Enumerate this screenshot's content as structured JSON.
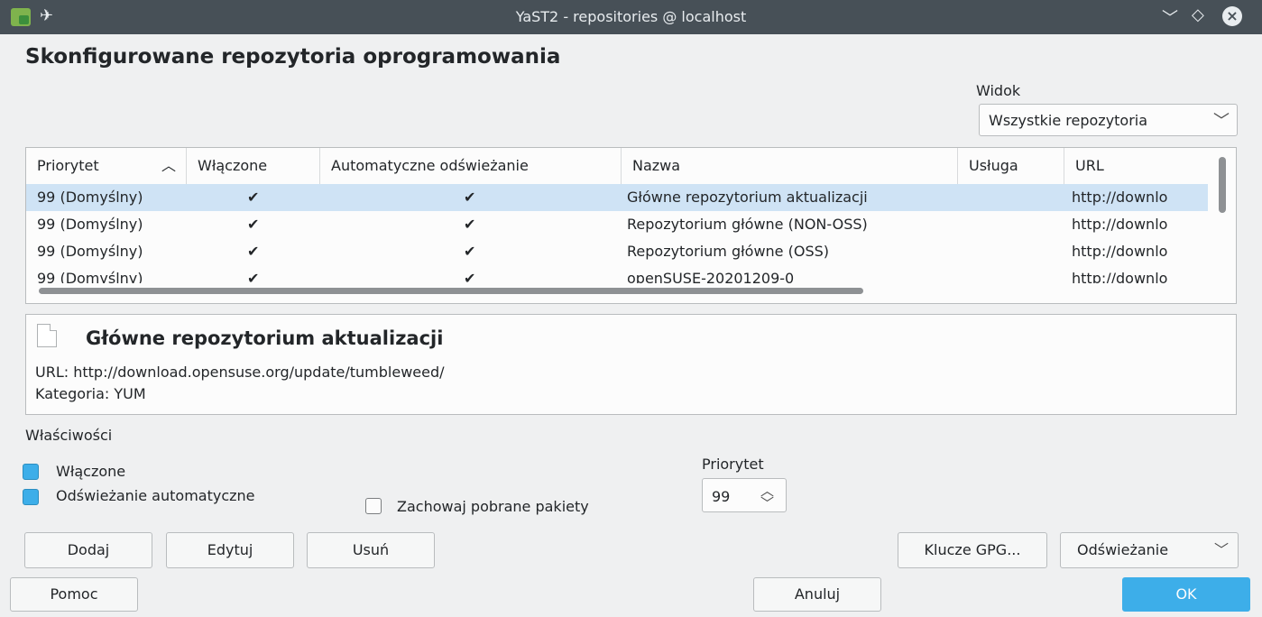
{
  "window": {
    "title": "YaST2 - repositories @ localhost"
  },
  "heading": "Skonfigurowane repozytoria oprogramowania",
  "view": {
    "label": "Widok",
    "selected": "Wszystkie repozytoria"
  },
  "table": {
    "columns": [
      "Priorytet",
      "Włączone",
      "Automatyczne odświeżanie",
      "Nazwa",
      "Usługa",
      "URL"
    ],
    "rows": [
      {
        "priority": "99 (Domyślny)",
        "enabled": "✔",
        "autorefresh": "✔",
        "name": "Główne repozytorium aktualizacji",
        "service": "",
        "url": "http://downlo"
      },
      {
        "priority": "99 (Domyślny)",
        "enabled": "✔",
        "autorefresh": "✔",
        "name": "Repozytorium główne (NON-OSS)",
        "service": "",
        "url": "http://downlo"
      },
      {
        "priority": "99 (Domyślny)",
        "enabled": "✔",
        "autorefresh": "✔",
        "name": "Repozytorium główne (OSS)",
        "service": "",
        "url": "http://downlo"
      },
      {
        "priority": "99 (Domyślny)",
        "enabled": "✔",
        "autorefresh": "✔",
        "name": "openSUSE-20201209-0",
        "service": "",
        "url": "http://downlo"
      }
    ]
  },
  "details": {
    "title": "Główne repozytorium aktualizacji",
    "url_line": "URL: http://download.opensuse.org/update/tumbleweed/",
    "category_line": "Kategoria: YUM"
  },
  "properties": {
    "label": "Właściwości",
    "enabled_label": "Włączone",
    "enabled_checked": true,
    "autorefresh_label": "Odświeżanie automatyczne",
    "autorefresh_checked": true,
    "keep_packages_label": "Zachowaj pobrane pakiety",
    "keep_packages_checked": false,
    "priority_label": "Priorytet",
    "priority_value": "99"
  },
  "buttons": {
    "add": "Dodaj",
    "edit": "Edytuj",
    "delete": "Usuń",
    "gpg": "Klucze GPG...",
    "refresh": "Odświeżanie",
    "help": "Pomoc",
    "cancel": "Anuluj",
    "ok": "OK"
  }
}
